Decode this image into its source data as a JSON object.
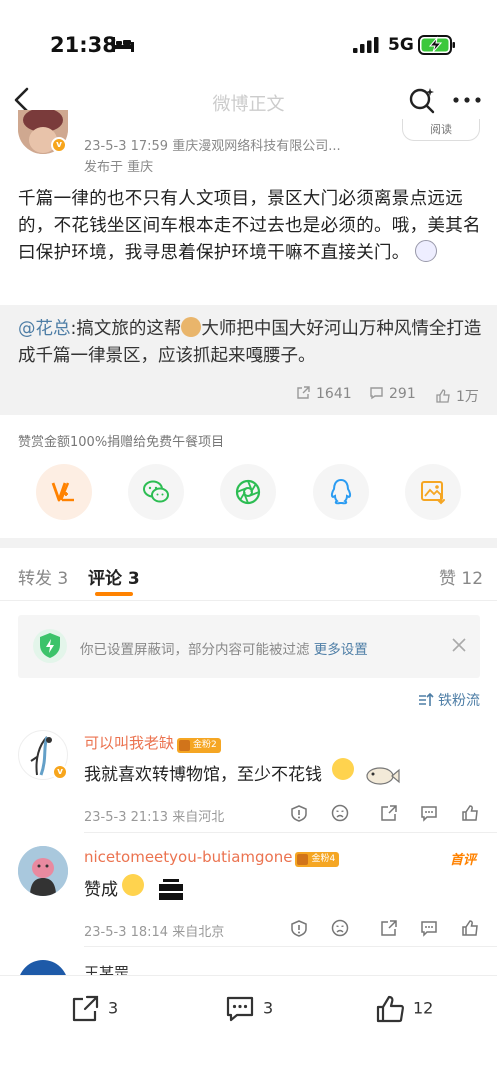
{
  "status": {
    "time": "21:38",
    "network": "5G"
  },
  "nav": {
    "title": "微博正文"
  },
  "post": {
    "meta": "23-5-3 17:59   重庆漫观网络科技有限公司...",
    "location": "发布于  重庆",
    "read_label": "阅读",
    "text": "千篇一律的也不只有人文项目，景区大门必须离景点远远的，不花钱坐区间车根本走不过去也是必须的。哦，美其名曰保护环境，我寻思着保护环境干嘛不直接关门。"
  },
  "repost": {
    "mention": "@花总",
    "text_before": ":搞文旅的这帮",
    "text_after": "大师把中国大好河山万种风情全打造成千篇一律景区，应该抓起来嘎腰子。",
    "shares": "1641",
    "comments": "291",
    "likes": "1万"
  },
  "reward_note": "赞赏金额100%捐赠给免费午餐项目",
  "share_targets": [
    {
      "name": "weibo-reward"
    },
    {
      "name": "wechat"
    },
    {
      "name": "moments"
    },
    {
      "name": "qq"
    },
    {
      "name": "save-image"
    }
  ],
  "tabs": {
    "repost": "转发 3",
    "comments": "评论 3",
    "likes": "赞 12"
  },
  "notice": {
    "text": "你已设置屏蔽词，部分内容可能被过滤",
    "link": "更多设置"
  },
  "sort_label": "铁粉流",
  "comments": [
    {
      "name": "可以叫我老缺",
      "badge": "金粉2",
      "text": "我就喜欢转博物馆，至少不花钱",
      "meta": "23-5-3 21:13  来自河北"
    },
    {
      "name": "nicetomeetyou-butiamgone",
      "badge": "金粉4",
      "tag": "首评",
      "text": "赞成",
      "meta": "23-5-3 18:14  来自北京"
    },
    {
      "name": "王某罡"
    }
  ],
  "bottom": {
    "reposts": "3",
    "comments": "3",
    "likes": "12"
  },
  "colors": {
    "accent": "#ff8200",
    "link": "#4e7ea6",
    "name_orange": "#eb7350"
  }
}
